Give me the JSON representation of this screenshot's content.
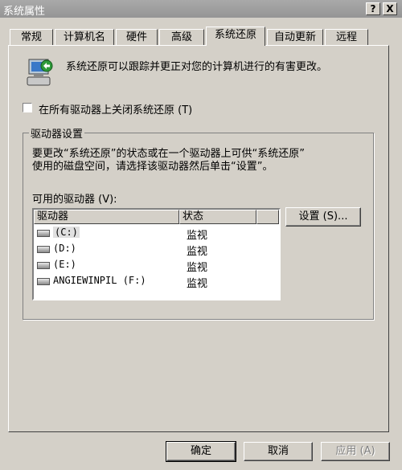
{
  "window": {
    "title": "系统属性",
    "help_glyph": "?",
    "close_glyph": "X"
  },
  "tabs": [
    {
      "label": "常规",
      "active": false
    },
    {
      "label": "计算机名",
      "active": false
    },
    {
      "label": "硬件",
      "active": false
    },
    {
      "label": "高级",
      "active": false
    },
    {
      "label": "系统还原",
      "active": true
    },
    {
      "label": "自动更新",
      "active": false
    },
    {
      "label": "远程",
      "active": false
    }
  ],
  "intro": {
    "text": "系统还原可以跟踪并更正对您的计算机进行的有害更改。",
    "icon": "system-restore-icon"
  },
  "disable_all": {
    "label": "在所有驱动器上关闭系统还原 (T)",
    "checked": false
  },
  "drive_settings": {
    "legend": "驱动器设置",
    "description_line1": "要更改“系统还原”的状态或在一个驱动器上可供“系统还原”",
    "description_line2": "使用的磁盘空间，请选择该驱动器然后单击“设置”。",
    "available_label": "可用的驱动器 (V):",
    "columns": [
      "驱动器",
      "状态"
    ],
    "drives": [
      {
        "name": "(C:)",
        "status": "监视",
        "icon": "hard-drive-icon"
      },
      {
        "name": "(D:)",
        "status": "监视",
        "icon": "hard-drive-icon"
      },
      {
        "name": "(E:)",
        "status": "监视",
        "icon": "hard-drive-icon"
      },
      {
        "name": "ANGIEWINPIL (F:)",
        "status": "监视",
        "icon": "hard-drive-icon"
      }
    ],
    "settings_button": "设置 (S)..."
  },
  "buttons": {
    "ok": "确定",
    "cancel": "取消",
    "apply": "应用 (A)"
  }
}
